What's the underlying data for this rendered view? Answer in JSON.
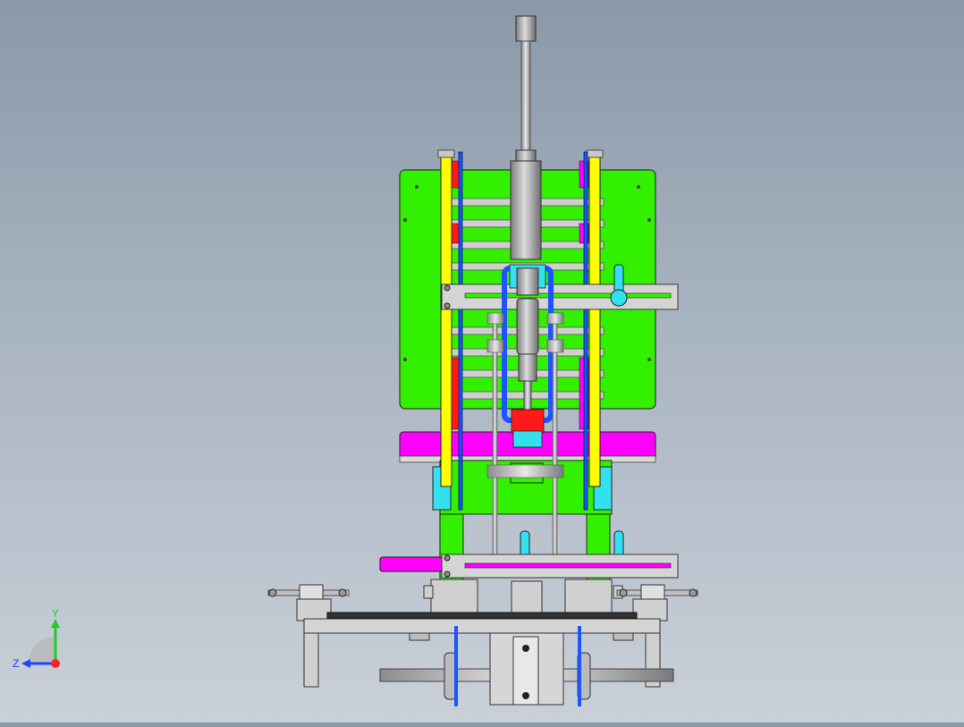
{
  "view": {
    "background_top": "#8a98a8",
    "background_bottom": "#c9d0d8"
  },
  "model": {
    "colors": {
      "panel": "#33f000",
      "rail": "#ffff00",
      "magenta": "#ff00ff",
      "red": "#ff1a1a",
      "blue": "#1a55ff",
      "cyan": "#33e0f0",
      "steel": "#c8c8c8",
      "dark": "#333333"
    }
  },
  "triad": {
    "y_label": "Y",
    "z_label": "Z",
    "y_color": "#22cc22",
    "z_color": "#2244ff",
    "origin_color": "#ff2222"
  }
}
